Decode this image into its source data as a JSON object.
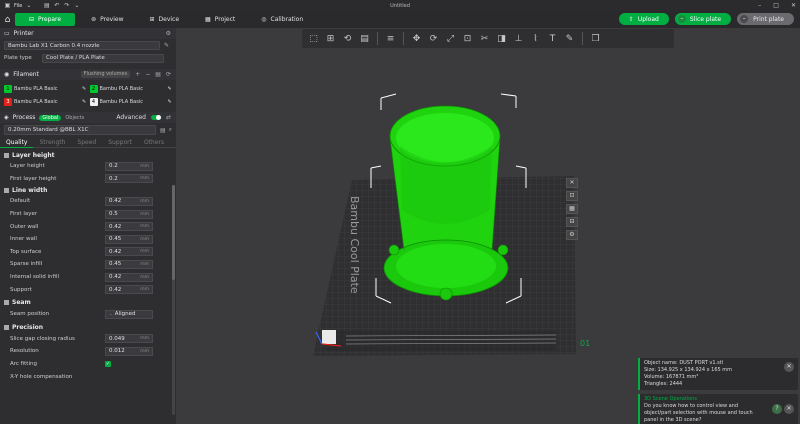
{
  "titlebar": {
    "file_menu": "File",
    "window_title": "Untitled"
  },
  "nav": {
    "tabs": [
      {
        "label": "Prepare",
        "icon": "prepare-icon",
        "active": true
      },
      {
        "label": "Preview",
        "icon": "preview-icon",
        "active": false
      },
      {
        "label": "Device",
        "icon": "device-icon",
        "active": false
      },
      {
        "label": "Project",
        "icon": "project-icon",
        "active": false
      },
      {
        "label": "Calibration",
        "icon": "calibration-icon",
        "active": false
      }
    ],
    "upload_label": "Upload",
    "slice_label": "Slice plate",
    "print_label": "Print plate"
  },
  "printer": {
    "section_title": "Printer",
    "printer_name": "Bambu Lab X1 Carbon 0.4 nozzle",
    "plate_type_label": "Plate type",
    "plate_type_value": "Cool Plate / PLA Plate"
  },
  "filament": {
    "section_title": "Filament",
    "flush_label": "Flushing volumes",
    "items": [
      {
        "num": "1",
        "name": "Bambu PLA Basic",
        "color": "#00c92e"
      },
      {
        "num": "2",
        "name": "Bambu PLA Basic",
        "color": "#00c92e"
      },
      {
        "num": "3",
        "name": "Bambu PLA Basic",
        "color": "#e2231a"
      },
      {
        "num": "4",
        "name": "Bambu PLA Basic",
        "color": "#f0f0f0"
      }
    ]
  },
  "process": {
    "section_title": "Process",
    "global_label": "Global",
    "objects_label": "Objects",
    "advanced_label": "Advanced",
    "advanced_on": true,
    "profile": "0.20mm Standard @BBL X1C",
    "tabs": [
      "Quality",
      "Strength",
      "Speed",
      "Support",
      "Others"
    ],
    "active_tab": "Quality"
  },
  "settings": {
    "layer_height": {
      "title": "Layer height",
      "rows": [
        {
          "label": "Layer height",
          "value": "0.2",
          "unit": "mm"
        },
        {
          "label": "First layer height",
          "value": "0.2",
          "unit": "mm"
        }
      ]
    },
    "line_width": {
      "title": "Line width",
      "rows": [
        {
          "label": "Default",
          "value": "0.42",
          "unit": "mm"
        },
        {
          "label": "First layer",
          "value": "0.5",
          "unit": "mm"
        },
        {
          "label": "Outer wall",
          "value": "0.42",
          "unit": "mm"
        },
        {
          "label": "Inner wall",
          "value": "0.45",
          "unit": "mm"
        },
        {
          "label": "Top surface",
          "value": "0.42",
          "unit": "mm"
        },
        {
          "label": "Sparse infill",
          "value": "0.45",
          "unit": "mm"
        },
        {
          "label": "Internal solid infill",
          "value": "0.42",
          "unit": "mm"
        },
        {
          "label": "Support",
          "value": "0.42",
          "unit": "mm"
        }
      ]
    },
    "seam": {
      "title": "Seam",
      "position_label": "Seam position",
      "position_value": "Aligned"
    },
    "precision": {
      "title": "Precision",
      "rows": [
        {
          "label": "Slice gap closing radius",
          "value": "0.049",
          "unit": "mm"
        },
        {
          "label": "Resolution",
          "value": "0.012",
          "unit": "mm"
        }
      ],
      "arc_label": "Arc fitting",
      "arc_checked": true,
      "xy_label": "X-Y hole compensation"
    }
  },
  "viewport": {
    "plate_label": "Bambu Cool Plate",
    "plate_number": "01",
    "model_color": "#1fd40f"
  },
  "notifications": {
    "object_info": {
      "name": "Object name: DUST PORT v1.stl",
      "size": "Size: 134.925 x 134.924 x 165 mm",
      "volume": "Volume: 167871 mm³",
      "triangles": "Triangles: 2444"
    },
    "tip": {
      "title": "3D Scene Operations",
      "text1": "Do you know how to control view and",
      "text2": "object/part selection with mouse and touch",
      "text3": "panel in the 3D scene?"
    }
  }
}
